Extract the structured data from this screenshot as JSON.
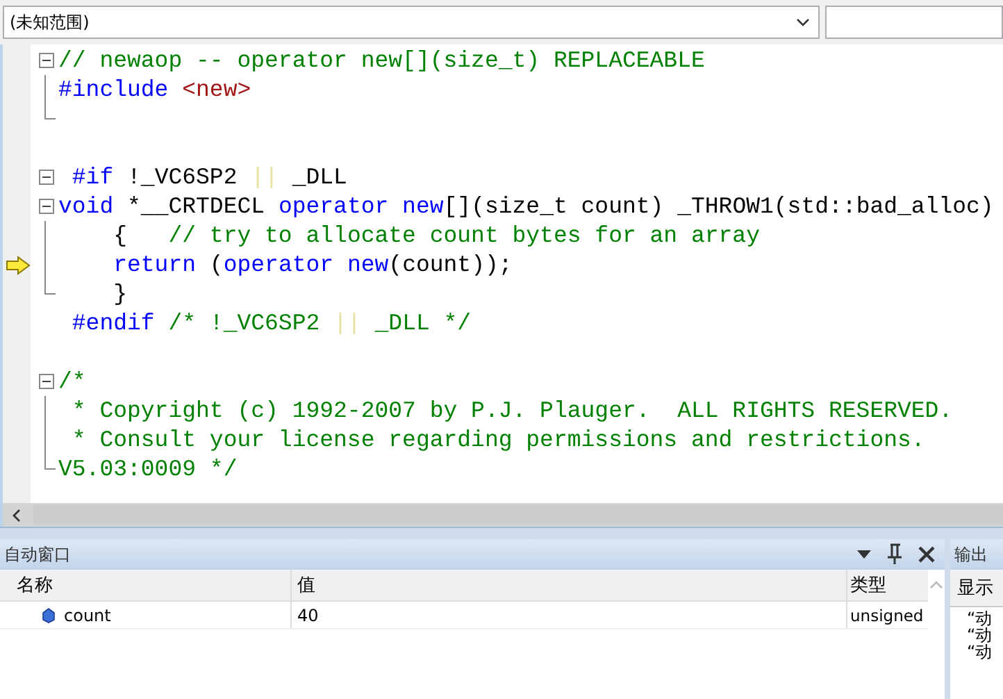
{
  "scope_selector": {
    "value": "(未知范围)"
  },
  "editor": {
    "lines": [
      {
        "kind": "fold-start",
        "current": false,
        "tokens": [
          {
            "kind": "comment",
            "text": "// newaop -- operator new[](size_t) REPLACEABLE"
          }
        ]
      },
      {
        "kind": "fold-body",
        "current": false,
        "tokens": [
          {
            "kind": "keyword",
            "text": "#include "
          },
          {
            "kind": "string",
            "text": "<new>"
          }
        ]
      },
      {
        "kind": "fold-end",
        "current": false
      },
      {
        "kind": "plain",
        "current": false
      },
      {
        "kind": "fold-start",
        "current": false,
        "tokens": [
          {
            "kind": "keyword",
            "text": " #if"
          },
          {
            "kind": "plain",
            "text": " !_VC6SP2 "
          },
          {
            "kind": "operator",
            "text": "||"
          },
          {
            "kind": "plain",
            "text": " _DLL"
          }
        ]
      },
      {
        "kind": "fold-start",
        "current": false,
        "tokens": [
          {
            "kind": "keyword",
            "text": "void"
          },
          {
            "kind": "plain",
            "text": " *__CRTDECL "
          },
          {
            "kind": "keyword",
            "text": "operator new"
          },
          {
            "kind": "plain",
            "text": "[](size_t count) _THROW1(std::bad_alloc)"
          }
        ]
      },
      {
        "kind": "fold-body",
        "current": false,
        "tokens": [
          {
            "kind": "plain",
            "text": "    {   "
          },
          {
            "kind": "comment",
            "text": "// try to allocate count bytes for an array"
          }
        ]
      },
      {
        "kind": "fold-body",
        "current": true,
        "tokens": [
          {
            "kind": "keyword",
            "text": "    return"
          },
          {
            "kind": "plain",
            "text": " ("
          },
          {
            "kind": "keyword",
            "text": "operator new"
          },
          {
            "kind": "plain",
            "text": "(count));"
          }
        ]
      },
      {
        "kind": "fold-end",
        "current": false,
        "tokens": [
          {
            "kind": "plain",
            "text": "    }"
          }
        ]
      },
      {
        "kind": "plain",
        "current": false,
        "tokens": [
          {
            "kind": "keyword",
            "text": " #endif"
          },
          {
            "kind": "comment",
            "text": " /* !_VC6SP2 "
          },
          {
            "kind": "operator",
            "text": "||"
          },
          {
            "kind": "comment",
            "text": " _DLL */"
          }
        ]
      },
      {
        "kind": "plain",
        "current": false
      },
      {
        "kind": "fold-start",
        "current": false,
        "tokens": [
          {
            "kind": "comment",
            "text": "/*"
          }
        ]
      },
      {
        "kind": "fold-body",
        "current": false,
        "tokens": [
          {
            "kind": "comment",
            "text": " * Copyright (c) 1992-2007 by P.J. Plauger.  ALL RIGHTS RESERVED."
          }
        ]
      },
      {
        "kind": "fold-body",
        "current": false,
        "tokens": [
          {
            "kind": "comment",
            "text": " * Consult your license regarding permissions and restrictions."
          }
        ]
      },
      {
        "kind": "fold-end",
        "current": false,
        "tokens": [
          {
            "kind": "comment",
            "text": "V5.03:0009 */"
          }
        ]
      }
    ]
  },
  "autos_panel": {
    "title": "自动窗口",
    "columns": [
      "名称",
      "值",
      "类型"
    ],
    "rows": [
      {
        "name": "count",
        "value": "40",
        "type": "unsigned"
      }
    ]
  },
  "output_panel": {
    "title": "输出",
    "show_output_label": "显示",
    "lines": [
      "“动",
      "“动",
      "“动"
    ]
  }
}
